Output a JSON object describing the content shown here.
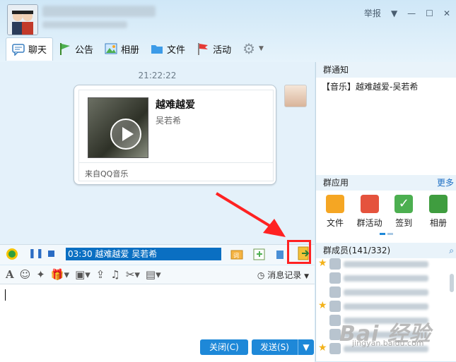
{
  "header": {
    "report_label": "举报",
    "tabs": [
      {
        "label": "聊天"
      },
      {
        "label": "公告"
      },
      {
        "label": "相册"
      },
      {
        "label": "文件"
      },
      {
        "label": "活动"
      }
    ]
  },
  "chat": {
    "timestamp": "21:22:22",
    "message": {
      "song_title": "越难越爱",
      "artist": "吴若希",
      "source": "来自QQ音乐"
    }
  },
  "player": {
    "now_playing": "03:30 越难越爱  吴若希"
  },
  "toolbar": {
    "history_label": "消息记录"
  },
  "input": {
    "close_label": "关闭(C)",
    "send_label": "发送(S)"
  },
  "sidebar": {
    "notice_header": "群通知",
    "notice_text": "【音乐】越难越爱-吴若希",
    "apps_header": "群应用",
    "apps_more": "更多",
    "apps": [
      {
        "label": "文件",
        "color": "#f5a623"
      },
      {
        "label": "群活动",
        "color": "#e5533d"
      },
      {
        "label": "签到",
        "color": "#4caf50"
      },
      {
        "label": "相册",
        "color": "#3f9d3f"
      }
    ],
    "members_header": "群成员(141/332)"
  },
  "watermark": {
    "brand": "Bai 经验",
    "url": "jingyan.baidu.com"
  },
  "colors": {
    "accent": "#1e88d8",
    "highlight_box": "#ff2222",
    "arrow": "#f22"
  }
}
